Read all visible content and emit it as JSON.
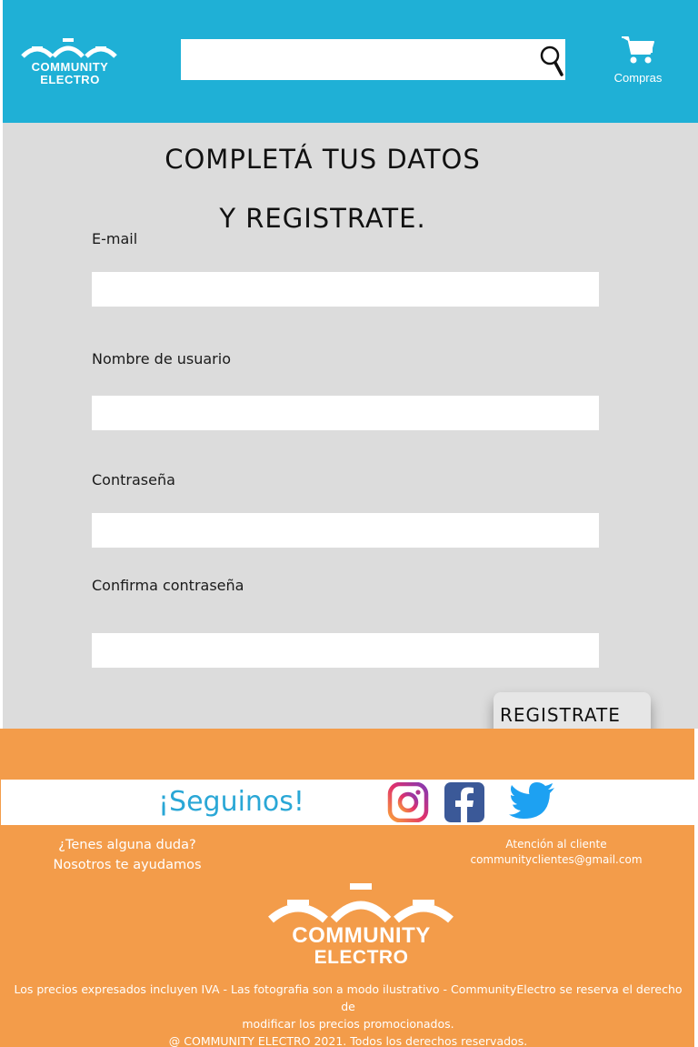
{
  "header": {
    "logo": {
      "line1": "COMMUNITY",
      "line2": "ELECTRO"
    },
    "search": {
      "value": "",
      "placeholder": ""
    },
    "cart_label": "Compras"
  },
  "form": {
    "title_line1": "COMPLETÁ TUS DATOS",
    "title_line2": "Y REGISTRATE.",
    "fields": [
      {
        "label": "E-mail",
        "value": ""
      },
      {
        "label": "Nombre de usuario",
        "value": ""
      },
      {
        "label": "Contraseña",
        "value": ""
      },
      {
        "label": "Confirma contraseña",
        "value": ""
      }
    ],
    "submit_label": "REGISTRATE"
  },
  "footer": {
    "follow_label": "¡Seguinos!",
    "social_icons": [
      "instagram-icon",
      "facebook-icon",
      "twitter-icon"
    ],
    "help_line1": "¿Tenes alguna duda?",
    "help_line2": "Nosotros te ayudamos",
    "contact_line1": "Atención al cliente",
    "contact_line2": "communityclientes@gmail.com",
    "logo": {
      "line1": "COMMUNITY",
      "line2": "ELECTRO"
    },
    "legal_line1": "Los precios expresados incluyen IVA - Las fotografia son a modo ilustrativo - CommunityElectro se reserva el derecho de",
    "legal_line2": "modificar los precios promocionados.",
    "legal_line3": "@ COMMUNITY ELECTRO 2021. Todos los derechos reservados."
  },
  "colors": {
    "header_bg": "#1fb0d6",
    "main_bg": "#dcdcdc",
    "footer_bg": "#f39c4a",
    "accent_text": "#2aa7d6",
    "facebook": "#3b5998",
    "twitter": "#1da1f2"
  }
}
